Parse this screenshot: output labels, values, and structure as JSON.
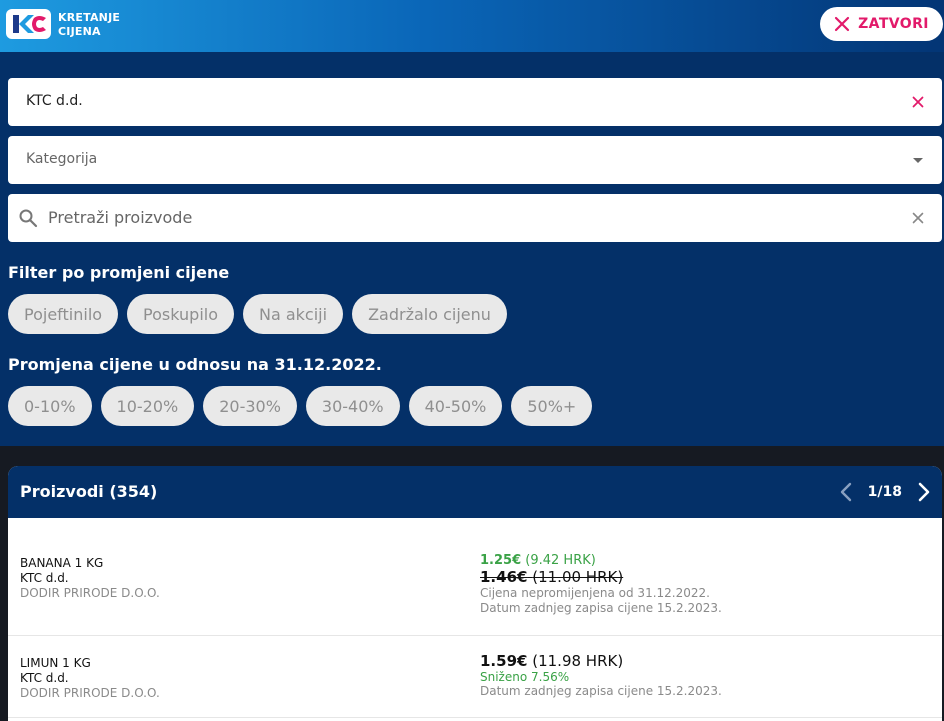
{
  "header": {
    "brand_line1": "KRETANJE",
    "brand_line2": "CIJENA",
    "close_label": "ZATVORI"
  },
  "filters": {
    "store_value": "KTC d.d.",
    "category_placeholder": "Kategorija",
    "search_placeholder": "Pretraži proizvode",
    "price_change_title": "Filter po promjeni cijene",
    "price_change_chips": [
      "Pojeftinilo",
      "Poskupilo",
      "Na akciji",
      "Zadržalo cijenu"
    ],
    "range_title": "Promjena cijene u odnosu na 31.12.2022.",
    "range_chips": [
      "0-10%",
      "10-20%",
      "20-30%",
      "30-40%",
      "40-50%",
      "50%+"
    ]
  },
  "products": {
    "title": "Proizvodi (354)",
    "page": "1/18",
    "items": [
      {
        "name": "BANANA 1 KG",
        "store": "KTC d.d.",
        "supplier": "DODIR PRIRODE D.O.O.",
        "price_eur": "1.25€",
        "price_hrk": "(9.42 HRK)",
        "old_price_eur": "1.46€",
        "old_price_hrk": "(11.00 HRK)",
        "note": "Cijena nepromijenjena od 31.12.2022.",
        "last_record": "Datum zadnjeg zapisa cijene 15.2.2023."
      },
      {
        "name": "LIMUN 1 KG",
        "store": "KTC d.d.",
        "supplier": "DODIR PRIRODE D.O.O.",
        "price_eur": "1.59€",
        "price_hrk": "(11.98 HRK)",
        "discount": "Sniženo 7.56%",
        "last_record": "Datum zadnjeg zapisa cijene 15.2.2023."
      }
    ]
  },
  "colors": {
    "accent": "#e21a6a",
    "navy": "#043068",
    "green": "#3aa246"
  }
}
